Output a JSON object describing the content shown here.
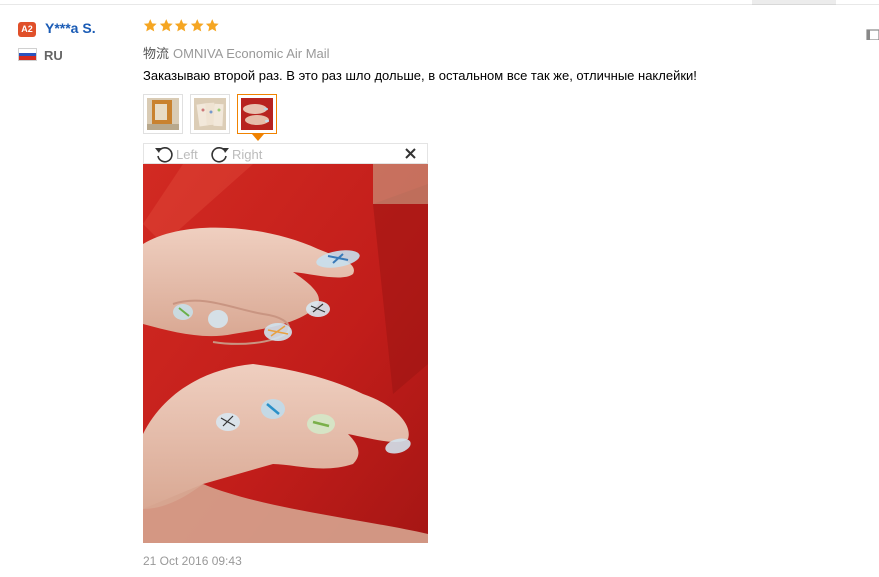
{
  "review": {
    "user": {
      "level_badge": "A2",
      "name": "Y***a S.",
      "country": "RU"
    },
    "rating_stars": 5,
    "rating_max": 5,
    "shipping": {
      "label": "物流",
      "method": "OMNIVA Economic Air Mail"
    },
    "comment": "Заказываю второй раз. В это раз шло дольше, в остальном все так же, отличные наклейки!",
    "thumbnails": [
      {
        "icon": "product-package-photo"
      },
      {
        "icon": "nail-stickers-photo"
      },
      {
        "icon": "nails-on-hands-photo"
      }
    ],
    "selected_thumbnail": 3,
    "viewer": {
      "rotate_left_label": "Left",
      "rotate_right_label": "Right",
      "close_icon": "close-icon"
    },
    "date": "21 Oct 2016 09:43"
  },
  "colors": {
    "accent_orange": "#f08200",
    "star": "#f5a623",
    "username_blue": "#1a5bb5",
    "badge_red": "#e0502a",
    "photo_background_red": "#c8201e"
  }
}
